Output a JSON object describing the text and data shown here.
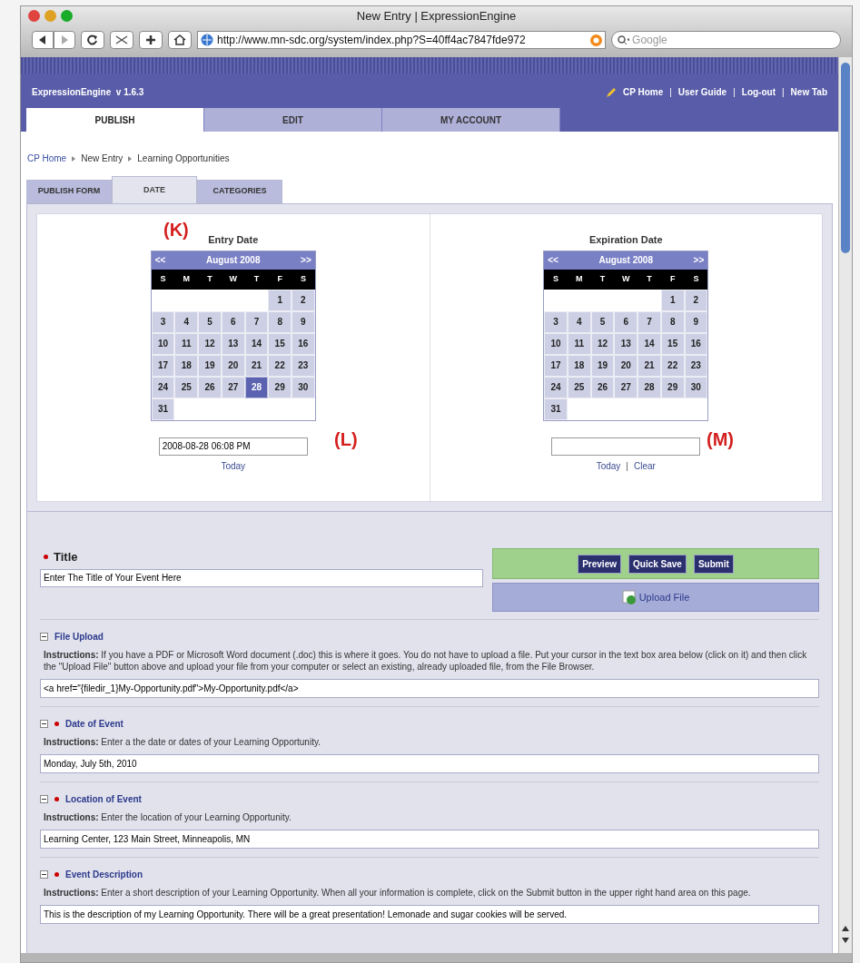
{
  "window": {
    "title": "New Entry | ExpressionEngine"
  },
  "toolbar": {
    "url": "http://www.mn-sdc.org/system/index.php?S=40ff4ac7847fde972",
    "search_placeholder": "Google"
  },
  "header": {
    "brand": "ExpressionEngine  v 1.6.3",
    "links": [
      "CP Home",
      "User Guide",
      "Log-out",
      "New Tab"
    ],
    "separator": "|"
  },
  "main_tabs": [
    {
      "label": "PUBLISH",
      "selected": true
    },
    {
      "label": "EDIT",
      "selected": false
    },
    {
      "label": "MY ACCOUNT",
      "selected": false
    }
  ],
  "breadcrumb": [
    "CP Home",
    "New Entry",
    "Learning Opportunities"
  ],
  "form_tabs": [
    {
      "label": "PUBLISH FORM",
      "selected": false
    },
    {
      "label": "DATE",
      "selected": true
    },
    {
      "label": "CATEGORIES",
      "selected": false
    }
  ],
  "calendars": [
    {
      "title": "Entry Date",
      "prev": "<<",
      "month": "August 2008",
      "next": ">>",
      "weekdays": [
        "S",
        "M",
        "T",
        "W",
        "T",
        "F",
        "S"
      ],
      "weeks": [
        [
          {
            "kind": "blank"
          },
          {
            "kind": "blank"
          },
          {
            "kind": "blank"
          },
          {
            "kind": "blank"
          },
          {
            "kind": "blank"
          },
          {
            "kind": "day",
            "d": "1",
            "selected": false
          },
          {
            "kind": "day",
            "d": "2",
            "selected": false
          }
        ],
        [
          {
            "kind": "day",
            "d": "3",
            "selected": false
          },
          {
            "kind": "day",
            "d": "4",
            "selected": false
          },
          {
            "kind": "day",
            "d": "5",
            "selected": false
          },
          {
            "kind": "day",
            "d": "6",
            "selected": false
          },
          {
            "kind": "day",
            "d": "7",
            "selected": false
          },
          {
            "kind": "day",
            "d": "8",
            "selected": false
          },
          {
            "kind": "day",
            "d": "9",
            "selected": false
          }
        ],
        [
          {
            "kind": "day",
            "d": "10",
            "selected": false
          },
          {
            "kind": "day",
            "d": "11",
            "selected": false
          },
          {
            "kind": "day",
            "d": "12",
            "selected": false
          },
          {
            "kind": "day",
            "d": "13",
            "selected": false
          },
          {
            "kind": "day",
            "d": "14",
            "selected": false
          },
          {
            "kind": "day",
            "d": "15",
            "selected": false
          },
          {
            "kind": "day",
            "d": "16",
            "selected": false
          }
        ],
        [
          {
            "kind": "day",
            "d": "17",
            "selected": false
          },
          {
            "kind": "day",
            "d": "18",
            "selected": false
          },
          {
            "kind": "day",
            "d": "19",
            "selected": false
          },
          {
            "kind": "day",
            "d": "20",
            "selected": false
          },
          {
            "kind": "day",
            "d": "21",
            "selected": false
          },
          {
            "kind": "day",
            "d": "22",
            "selected": false
          },
          {
            "kind": "day",
            "d": "23",
            "selected": false
          }
        ],
        [
          {
            "kind": "day",
            "d": "24",
            "selected": false
          },
          {
            "kind": "day",
            "d": "25",
            "selected": false
          },
          {
            "kind": "day",
            "d": "26",
            "selected": false
          },
          {
            "kind": "day",
            "d": "27",
            "selected": false
          },
          {
            "kind": "day",
            "d": "28",
            "selected": true
          },
          {
            "kind": "day",
            "d": "29",
            "selected": false
          },
          {
            "kind": "day",
            "d": "30",
            "selected": false
          }
        ],
        [
          {
            "kind": "day",
            "d": "31",
            "selected": false
          },
          {
            "kind": "blank"
          },
          {
            "kind": "blank"
          },
          {
            "kind": "blank"
          },
          {
            "kind": "blank"
          },
          {
            "kind": "blank"
          },
          {
            "kind": "blank"
          }
        ]
      ],
      "value": "2008-08-28 06:08 PM",
      "links": [
        "Today"
      ]
    },
    {
      "title": "Expiration Date",
      "prev": "<<",
      "month": "August 2008",
      "next": ">>",
      "weekdays": [
        "S",
        "M",
        "T",
        "W",
        "T",
        "F",
        "S"
      ],
      "weeks": [
        [
          {
            "kind": "blank"
          },
          {
            "kind": "blank"
          },
          {
            "kind": "blank"
          },
          {
            "kind": "blank"
          },
          {
            "kind": "blank"
          },
          {
            "kind": "day",
            "d": "1",
            "selected": false
          },
          {
            "kind": "day",
            "d": "2",
            "selected": false
          }
        ],
        [
          {
            "kind": "day",
            "d": "3",
            "selected": false
          },
          {
            "kind": "day",
            "d": "4",
            "selected": false
          },
          {
            "kind": "day",
            "d": "5",
            "selected": false
          },
          {
            "kind": "day",
            "d": "6",
            "selected": false
          },
          {
            "kind": "day",
            "d": "7",
            "selected": false
          },
          {
            "kind": "day",
            "d": "8",
            "selected": false
          },
          {
            "kind": "day",
            "d": "9",
            "selected": false
          }
        ],
        [
          {
            "kind": "day",
            "d": "10",
            "selected": false
          },
          {
            "kind": "day",
            "d": "11",
            "selected": false
          },
          {
            "kind": "day",
            "d": "12",
            "selected": false
          },
          {
            "kind": "day",
            "d": "13",
            "selected": false
          },
          {
            "kind": "day",
            "d": "14",
            "selected": false
          },
          {
            "kind": "day",
            "d": "15",
            "selected": false
          },
          {
            "kind": "day",
            "d": "16",
            "selected": false
          }
        ],
        [
          {
            "kind": "day",
            "d": "17",
            "selected": false
          },
          {
            "kind": "day",
            "d": "18",
            "selected": false
          },
          {
            "kind": "day",
            "d": "19",
            "selected": false
          },
          {
            "kind": "day",
            "d": "20",
            "selected": false
          },
          {
            "kind": "day",
            "d": "21",
            "selected": false
          },
          {
            "kind": "day",
            "d": "22",
            "selected": false
          },
          {
            "kind": "day",
            "d": "23",
            "selected": false
          }
        ],
        [
          {
            "kind": "day",
            "d": "24",
            "selected": false
          },
          {
            "kind": "day",
            "d": "25",
            "selected": false
          },
          {
            "kind": "day",
            "d": "26",
            "selected": false
          },
          {
            "kind": "day",
            "d": "27",
            "selected": false
          },
          {
            "kind": "day",
            "d": "28",
            "selected": false
          },
          {
            "kind": "day",
            "d": "29",
            "selected": false
          },
          {
            "kind": "day",
            "d": "30",
            "selected": false
          }
        ],
        [
          {
            "kind": "day",
            "d": "31",
            "selected": false
          },
          {
            "kind": "blank"
          },
          {
            "kind": "blank"
          },
          {
            "kind": "blank"
          },
          {
            "kind": "blank"
          },
          {
            "kind": "blank"
          },
          {
            "kind": "blank"
          }
        ]
      ],
      "links": [
        "Today",
        "Clear"
      ]
    }
  ],
  "annotations": [
    "(K)",
    "(L)",
    "(M)"
  ],
  "title_field": {
    "label": "Title",
    "required": true,
    "value": "Enter The Title of Your Event Here"
  },
  "actions": {
    "buttons": [
      "Preview",
      "Quick Save",
      "Submit"
    ],
    "upload": "Upload File"
  },
  "fields": [
    {
      "label": "File Upload",
      "required": false,
      "instructions": "**Instructions:** If you have a PDF or Microsoft Word document (.doc) this is where it goes. You do not have to upload a file. Put your cursor in the text box area below (click on it) and then click the \"Upload File\" button above and upload your file from your computer or select an existing, already uploaded file, from the File Browser.",
      "value": "<a href=\"{filedir_1}My-Opportunity.pdf\">My-Opportunity.pdf</a>"
    },
    {
      "label": "Date of Event",
      "required": true,
      "instructions": "**Instructions:** Enter a the date or dates of your Learning Opportunity.",
      "value": "Monday, July 5th, 2010"
    },
    {
      "label": "Location of Event",
      "required": true,
      "instructions": "**Instructions:** Enter the location of your Learning Opportunity.",
      "value": "Learning Center, 123 Main Street, Minneapolis, MN"
    },
    {
      "label": "Event Description",
      "required": true,
      "instructions": "**Instructions:** Enter a short description of your Learning Opportunity. When all your information is complete, click on the Submit button in the upper right hand area on this page.",
      "value": "This is the description of my Learning Opportunity. There will be a great presentation! Lemonade and sugar cookies will be served."
    }
  ]
}
